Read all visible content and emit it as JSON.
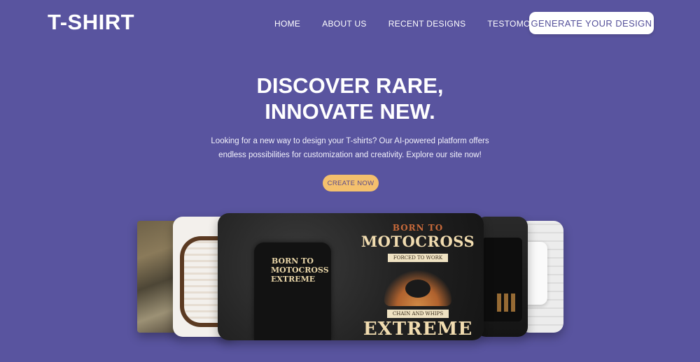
{
  "brand": {
    "logo": "T-SHIRT"
  },
  "nav": {
    "items": [
      {
        "label": "HOME"
      },
      {
        "label": "ABOUT US"
      },
      {
        "label": "RECENT DESIGNS"
      },
      {
        "label": "TESTOMONAIL"
      }
    ],
    "cta_label": "GENERATE YOUR DESIGN"
  },
  "hero": {
    "heading_line1": "DISCOVER RARE,",
    "heading_line2": "INNOVATE NEW.",
    "subtitle": "Looking for a new way to design your T-shirts? Our AI-powered platform offers endless possibilities for customization and creativity. Explore our site now!",
    "button_label": "CREATE NOW"
  },
  "gallery": {
    "featured": {
      "shirt_text": "BORN TO MOTOCROSS EXTREME",
      "line1": "BORN TO",
      "line2": "MOTOCROSS",
      "banner1": "FORCED TO WORK",
      "banner2": "CHAIN AND WHIPS",
      "line3": "EXTREME"
    }
  },
  "colors": {
    "background": "#59549f",
    "accent": "#f4c06d",
    "cta_text": "#54509a"
  }
}
